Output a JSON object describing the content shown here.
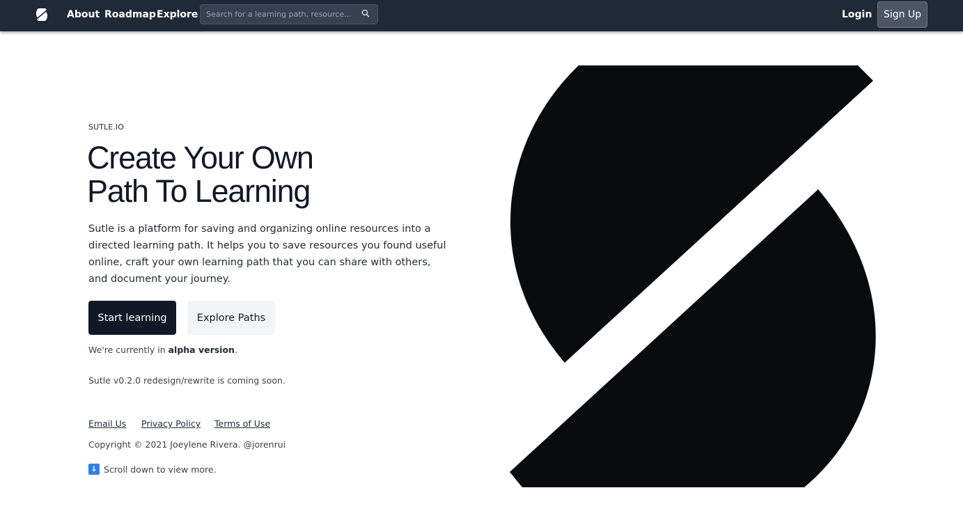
{
  "nav": {
    "about": "About",
    "roadmap": "Roadmap",
    "explore": "Explore",
    "search_placeholder": "Search for a learning path, resource...",
    "login": "Login",
    "signup": "Sign Up"
  },
  "hero": {
    "eyebrow": "SUTLE.IO",
    "title_line1": "Create Your Own",
    "title_line2": "Path To Learning",
    "description": "Sutle is a platform for saving and organizing online resources into a directed learning path. It helps you to save resources you found useful online, craft your own learning path that you can share with others, and document your journey.",
    "start_button": "Start learning",
    "explore_button": "Explore Paths",
    "alpha_prefix": "We're currently in ",
    "alpha_bold": "alpha version",
    "alpha_suffix": ".",
    "version_note": "Sutle v0.2.0 redesign/rewrite is coming soon."
  },
  "footer": {
    "email": "Email Us",
    "privacy": "Privacy Policy",
    "terms": "Terms of Use",
    "copyright": "Copyright © 2021 Joeylene Rivera. @jorenrui",
    "scroll_arrow": "↓",
    "scroll_hint": "Scroll down to view more."
  },
  "colors": {
    "navbar": "#1f2937",
    "primary": "#111827",
    "logo_fill": "#0a0b0d"
  }
}
